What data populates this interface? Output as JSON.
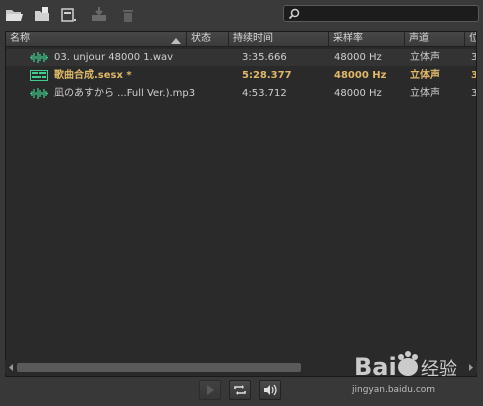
{
  "toolbar": {
    "icons": [
      "open-file-icon",
      "import-icon",
      "new-file-icon",
      "insert-into-multitrack-icon",
      "delete-icon"
    ],
    "search_placeholder": ""
  },
  "columns": [
    {
      "label": "名称"
    },
    {
      "label": "状态"
    },
    {
      "label": "持续时间"
    },
    {
      "label": "采样率"
    },
    {
      "label": "声道"
    },
    {
      "label": "位"
    }
  ],
  "files": [
    {
      "name": "03. unjour 48000 1.wav",
      "status": "",
      "duration": "3:35.666",
      "sample_rate": "48000 Hz",
      "channels": "立体声",
      "bits": "3",
      "icon": "waveform-icon",
      "bold": false
    },
    {
      "name": "歌曲合成.sesx *",
      "status": "",
      "duration": "5:28.377",
      "sample_rate": "48000 Hz",
      "channels": "立体声",
      "bits": "3",
      "icon": "multitrack-session-icon",
      "bold": true
    },
    {
      "name": "凪のあすから ...Full Ver.).mp3",
      "status": "",
      "duration": "4:53.712",
      "sample_rate": "48000 Hz",
      "channels": "立体声",
      "bits": "3",
      "icon": "waveform-icon",
      "bold": false
    }
  ],
  "bottom_buttons": [
    "play-icon",
    "loop-icon",
    "auto-play-icon"
  ],
  "watermark": {
    "text": "jingyan.baidu.com",
    "logo_text": "Bai百经验"
  },
  "colors": {
    "accent_bold": "#e0b868",
    "waveform": "#3ecf8e"
  }
}
